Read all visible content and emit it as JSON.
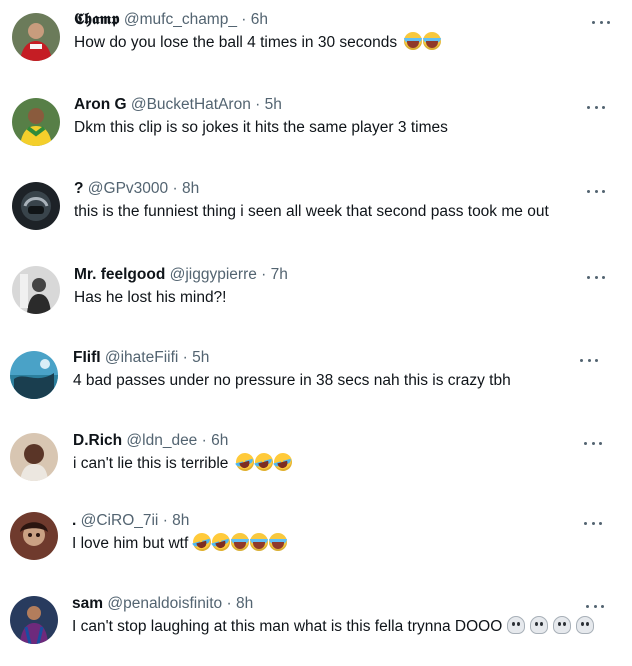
{
  "replies": [
    {
      "name": "𝕮𝖍𝖆𝖒𝖕",
      "handle": "@mufc_champ_",
      "dot": "·",
      "time": "6h",
      "text": "How do you lose the ball 4 times in 30 seconds",
      "emojis": [
        "loudly-crying-face",
        "loudly-crying-face"
      ]
    },
    {
      "name": "Aron G",
      "handle": "@BucketHatAron",
      "dot": "·",
      "time": "5h",
      "text": "Dkm this clip is so jokes it hits the same player 3 times",
      "emojis": []
    },
    {
      "name": "?",
      "handle": "@GPv3000",
      "dot": "·",
      "time": "8h",
      "text": "this is the funniest thing i seen all week that second pass took me out",
      "emojis": []
    },
    {
      "name": "Mr. feelgood",
      "handle": "@jiggypierre",
      "dot": "·",
      "time": "7h",
      "text": "Has he lost his mind?!",
      "emojis": []
    },
    {
      "name": "FIifI",
      "handle": "@ihateFiifi",
      "dot": "·",
      "time": "5h",
      "text": "4 bad passes under no pressure in 38 secs nah this is crazy tbh",
      "emojis": []
    },
    {
      "name": "D.Rich",
      "handle": "@ldn_dee",
      "dot": "·",
      "time": "6h",
      "text": "i can't lie this is terrible",
      "emojis": [
        "rolling-on-the-floor-laughing",
        "rolling-on-the-floor-laughing",
        "rolling-on-the-floor-laughing"
      ]
    },
    {
      "name": ".",
      "handle": "@CiRO_7ii",
      "dot": "·",
      "time": "8h",
      "text": "I love him but wtf",
      "emojis": [
        "face-with-tears-of-joy",
        "face-with-tears-of-joy",
        "loudly-crying-face",
        "loudly-crying-face",
        "loudly-crying-face"
      ]
    },
    {
      "name": "sam",
      "handle": "@penaldoisfinito",
      "dot": "·",
      "time": "8h",
      "text": "I can't stop laughing at this man what is this fella trynna DOOO",
      "emojis": [
        "skull",
        "skull",
        "skull",
        "skull"
      ]
    }
  ],
  "icons": {
    "more": "more-options-icon"
  }
}
